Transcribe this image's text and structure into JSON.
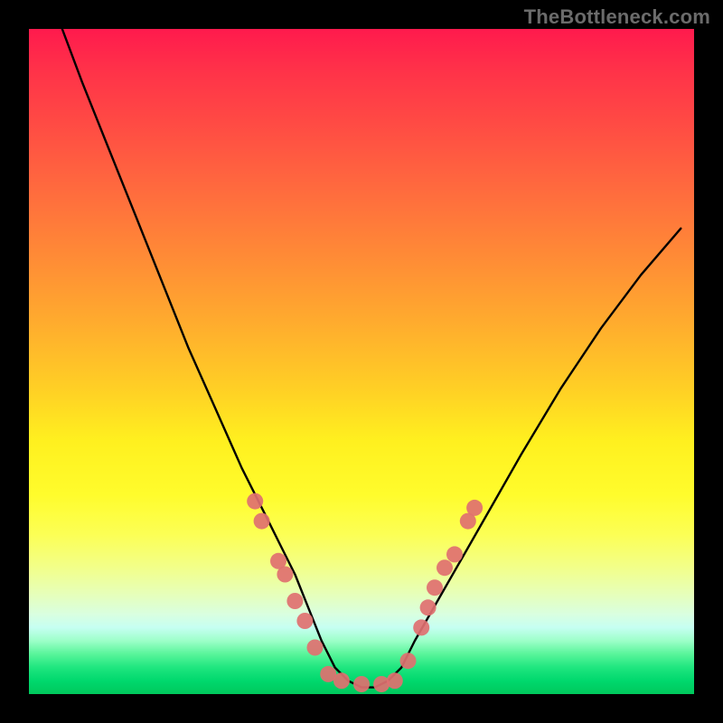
{
  "watermark": "TheBottleneck.com",
  "chart_data": {
    "type": "line",
    "title": "",
    "xlabel": "",
    "ylabel": "",
    "xlim": [
      0,
      100
    ],
    "ylim": [
      0,
      100
    ],
    "grid": false,
    "legend": false,
    "series": [
      {
        "name": "bottleneck-curve",
        "x": [
          5,
          8,
          12,
          16,
          20,
          24,
          28,
          32,
          36,
          38,
          40,
          42,
          44,
          46,
          48,
          50,
          52,
          54,
          56,
          58,
          62,
          66,
          70,
          74,
          80,
          86,
          92,
          98
        ],
        "y": [
          100,
          92,
          82,
          72,
          62,
          52,
          43,
          34,
          26,
          22,
          18,
          13,
          8,
          4,
          2,
          1,
          1,
          2,
          4,
          8,
          15,
          22,
          29,
          36,
          46,
          55,
          63,
          70
        ]
      }
    ],
    "markers": [
      {
        "x": 34,
        "y": 29
      },
      {
        "x": 35,
        "y": 26
      },
      {
        "x": 37.5,
        "y": 20
      },
      {
        "x": 38.5,
        "y": 18
      },
      {
        "x": 40,
        "y": 14
      },
      {
        "x": 41.5,
        "y": 11
      },
      {
        "x": 43,
        "y": 7
      },
      {
        "x": 45,
        "y": 3
      },
      {
        "x": 47,
        "y": 2
      },
      {
        "x": 50,
        "y": 1.5
      },
      {
        "x": 53,
        "y": 1.5
      },
      {
        "x": 55,
        "y": 2
      },
      {
        "x": 57,
        "y": 5
      },
      {
        "x": 59,
        "y": 10
      },
      {
        "x": 60,
        "y": 13
      },
      {
        "x": 61,
        "y": 16
      },
      {
        "x": 62.5,
        "y": 19
      },
      {
        "x": 64,
        "y": 21
      },
      {
        "x": 66,
        "y": 26
      },
      {
        "x": 67,
        "y": 28
      }
    ],
    "gradient_stops": [
      {
        "pos": 0,
        "color": "#ff1a4d"
      },
      {
        "pos": 50,
        "color": "#ffcf25"
      },
      {
        "pos": 75,
        "color": "#fcff55"
      },
      {
        "pos": 100,
        "color": "#00c85c"
      }
    ]
  }
}
